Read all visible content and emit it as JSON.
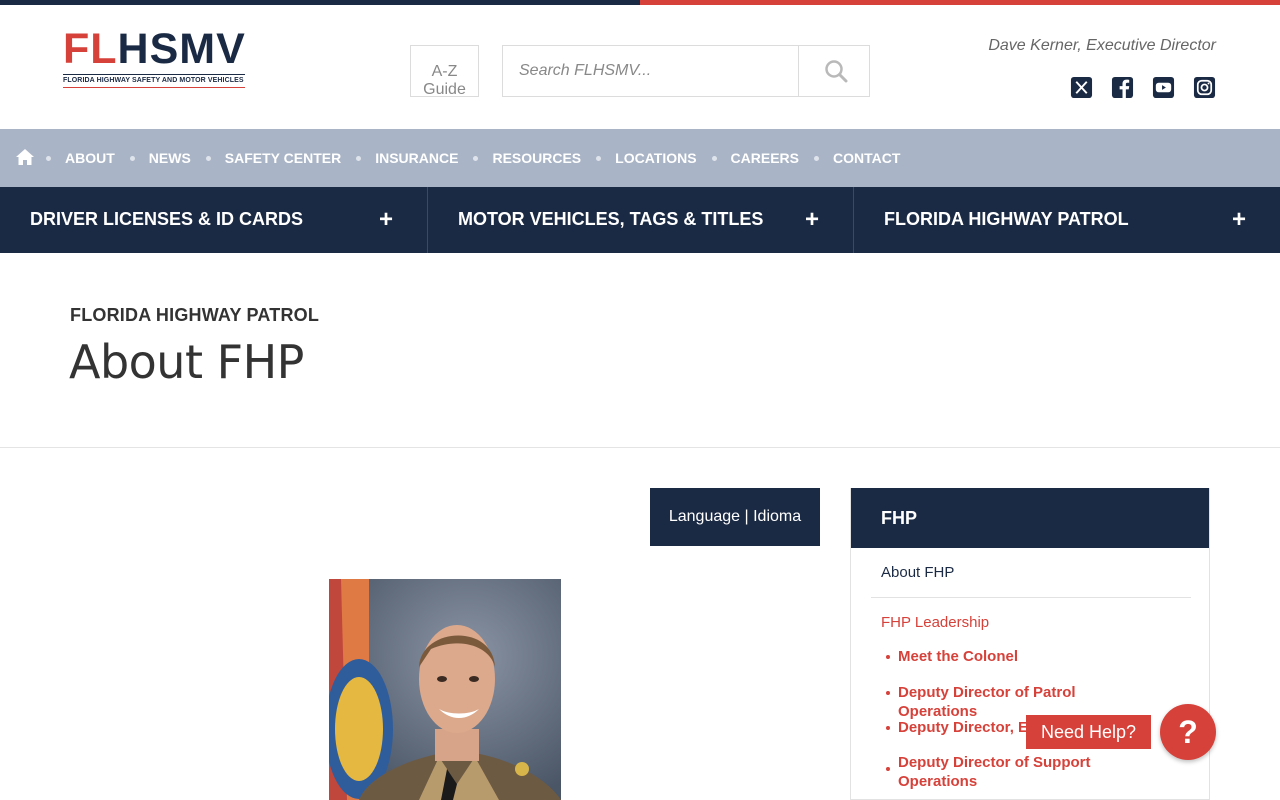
{
  "colors": {
    "navy": "#1b2a44",
    "red": "#d6413a",
    "utility_nav": "#a9b4c6"
  },
  "header": {
    "logo": {
      "fl": "FL",
      "hsmv": "HSMV",
      "tagline": "FLORIDA HIGHWAY SAFETY AND MOTOR VEHICLES"
    },
    "az_guide": {
      "line1": "A-Z",
      "line2": "Guide"
    },
    "search": {
      "placeholder": "Search FLHSMV..."
    },
    "director": "Dave Kerner, Executive Director",
    "social": [
      "x-icon",
      "facebook-icon",
      "youtube-icon",
      "instagram-icon"
    ]
  },
  "utility_nav": {
    "home_icon": "home-icon",
    "items": [
      "ABOUT",
      "NEWS",
      "SAFETY CENTER",
      "INSURANCE",
      "RESOURCES",
      "LOCATIONS",
      "CAREERS",
      "CONTACT"
    ]
  },
  "main_nav": {
    "items": [
      {
        "label": "DRIVER LICENSES & ID CARDS",
        "icon": "+"
      },
      {
        "label": "MOTOR VEHICLES, TAGS & TITLES",
        "icon": "+"
      },
      {
        "label": "FLORIDA HIGHWAY PATROL",
        "icon": "+"
      }
    ]
  },
  "hero": {
    "kicker": "FLORIDA HIGHWAY PATROL",
    "title": "About FHP"
  },
  "language_button": "Language | Idioma",
  "sidebar": {
    "heading": "FHP",
    "about": "About FHP",
    "leadership": "FHP Leadership",
    "sub_items": [
      "Meet the Colonel",
      "Deputy Director of Patrol Operations",
      "Deputy Director, Ex",
      "Deputy Director of Support Operations"
    ]
  },
  "help": {
    "label": "Need Help?",
    "icon_text": "?"
  }
}
